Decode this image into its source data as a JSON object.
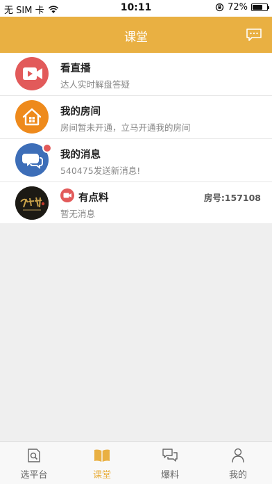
{
  "status_bar": {
    "carrier": "无 SIM 卡",
    "time": "10:11",
    "battery": "72%",
    "battery_level": 0.72
  },
  "nav": {
    "title": "课堂",
    "message_icon": "chat-bubble-icon"
  },
  "list": [
    {
      "title": "看直播",
      "subtitle": "达人实时解盘答疑",
      "icon": "video-camera-icon",
      "color": "#e25a5a"
    },
    {
      "title": "我的房间",
      "subtitle": "房间暂未开通，立马开通我的房间",
      "icon": "house-icon",
      "color": "#ee8a1c"
    },
    {
      "title": "我的消息",
      "subtitle": "540475发送新消息!",
      "icon": "chat-bubbles-icon",
      "color": "#3d6eb8"
    },
    {
      "title": "有点料",
      "subtitle": "暂无消息",
      "room": "房号:157108",
      "icon": "channel-avatar",
      "color": "#1a1a1a"
    }
  ],
  "tabs": [
    {
      "label": "选平台",
      "icon": "search-document-icon",
      "active": false
    },
    {
      "label": "课堂",
      "icon": "open-book-icon",
      "active": true
    },
    {
      "label": "爆料",
      "icon": "chat-bubbles-outline-icon",
      "active": false
    },
    {
      "label": "我的",
      "icon": "person-icon",
      "active": false
    }
  ],
  "colors": {
    "accent": "#e9b042",
    "tab_inactive": "#666666",
    "badge": "#e25a5a"
  }
}
